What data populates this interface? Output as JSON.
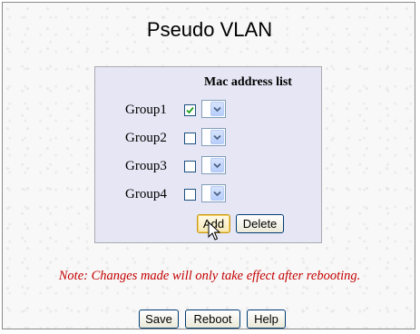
{
  "page": {
    "title": "Pseudo VLAN",
    "note": "Note: Changes made will only take effect after rebooting."
  },
  "mac_panel": {
    "heading": "Mac address list",
    "groups": [
      {
        "label": "Group1",
        "checked": true,
        "selected_value": ""
      },
      {
        "label": "Group2",
        "checked": false,
        "selected_value": ""
      },
      {
        "label": "Group3",
        "checked": false,
        "selected_value": ""
      },
      {
        "label": "Group4",
        "checked": false,
        "selected_value": ""
      }
    ],
    "add_label": "Add",
    "delete_label": "Delete"
  },
  "footer": {
    "save_label": "Save",
    "reboot_label": "Reboot",
    "help_label": "Help"
  },
  "colors": {
    "note": "#c40000",
    "panel_bg": "#e6e6f5",
    "checkmark": "#21a121",
    "dropdown_arrow": "#4d6185"
  },
  "icons": {
    "dropdown": "chevron-down-icon",
    "check": "checkmark-icon",
    "cursor": "mouse-pointer-icon"
  }
}
